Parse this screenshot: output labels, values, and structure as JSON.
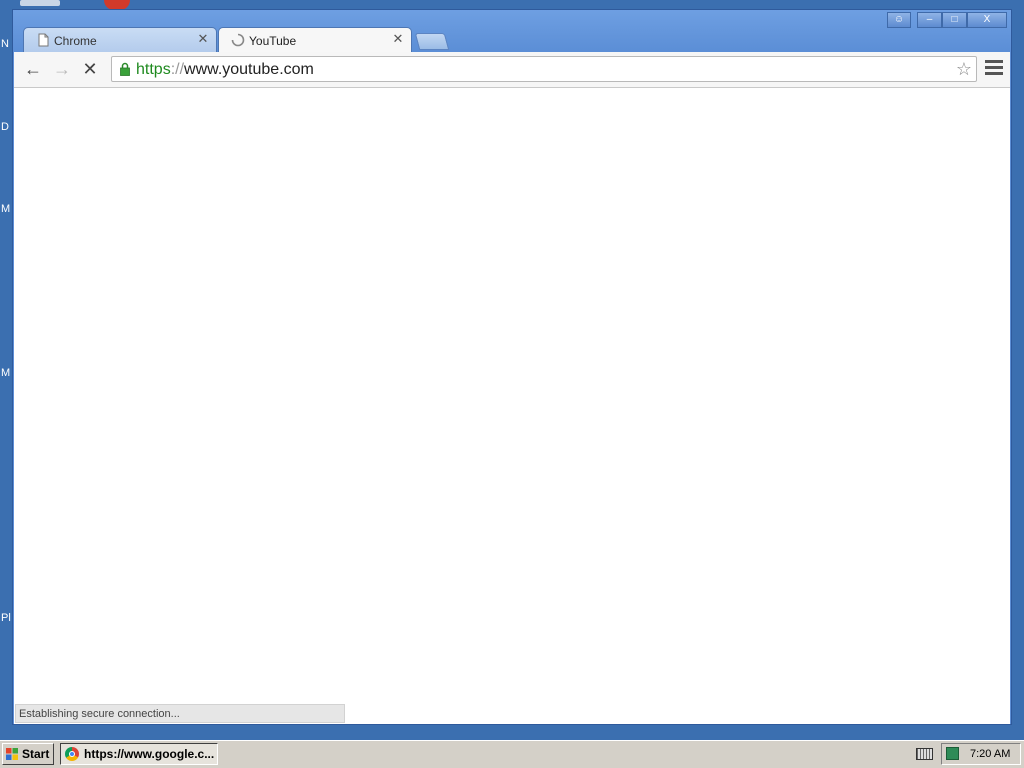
{
  "desktop": {
    "side_letters": [
      "N",
      "D",
      "M",
      "M",
      "Pl"
    ]
  },
  "window": {
    "tabs": [
      {
        "label": "Chrome",
        "active": false
      },
      {
        "label": "YouTube",
        "active": true
      }
    ],
    "controls": {
      "profile": "☺",
      "minimize": "–",
      "maximize": "□",
      "close": "X"
    }
  },
  "toolbar": {
    "back_icon": "←",
    "forward_icon": "→",
    "stop_icon": "✕",
    "url_scheme": "https",
    "url_sep": "://",
    "url_host": "www.youtube.com",
    "star_icon": "☆"
  },
  "status": {
    "text": "Establishing secure connection..."
  },
  "taskbar": {
    "start_label": "Start",
    "task_label": "https://www.google.c...",
    "clock": "7:20 AM"
  }
}
